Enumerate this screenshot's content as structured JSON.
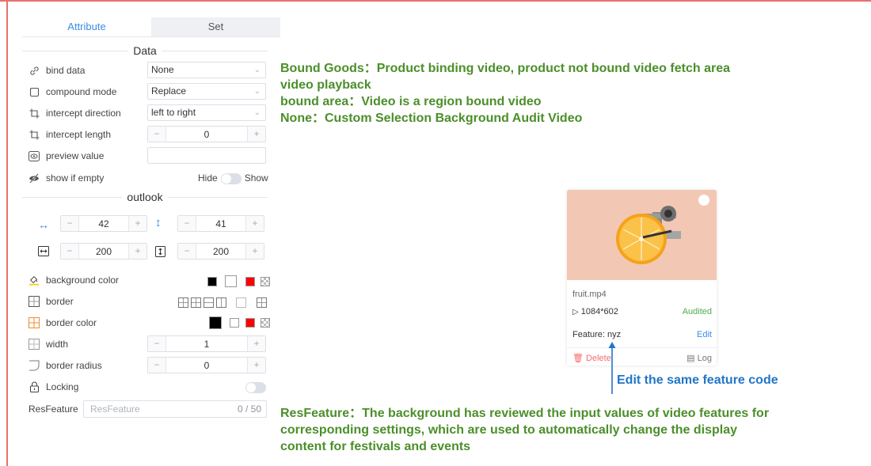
{
  "tabs": [
    {
      "label": "Attribute",
      "active": true
    },
    {
      "label": "Set",
      "active": false
    }
  ],
  "sections": {
    "data": "Data",
    "outlook": "outlook"
  },
  "fields": {
    "bind_data": {
      "label": "bind data",
      "value": "None"
    },
    "compound_mode": {
      "label": "compound mode",
      "value": "Replace"
    },
    "intercept_direction": {
      "label": "intercept direction",
      "value": "left to right"
    },
    "intercept_length": {
      "label": "intercept length",
      "value": "0"
    },
    "preview_value": {
      "label": "preview value",
      "value": ""
    },
    "show_if_empty": {
      "label": "show if empty",
      "off_label": "Hide",
      "on_label": "Show"
    }
  },
  "outlook": {
    "x": "42",
    "y": "41",
    "width": "200",
    "height": "200"
  },
  "style": {
    "background_color": {
      "label": "background color",
      "swatches": [
        "#000000",
        "#ffffff",
        "#ff0000",
        "checker"
      ]
    },
    "border": {
      "label": "border"
    },
    "border_color": {
      "label": "border color",
      "swatches": [
        "#000000",
        "#ffffff",
        "#ff0000",
        "checker"
      ]
    },
    "width": {
      "label": "width",
      "value": "1"
    },
    "border_radius": {
      "label": "border radius",
      "value": "0"
    },
    "locking": {
      "label": "Locking"
    },
    "res_feature": {
      "label": "ResFeature",
      "placeholder": "ResFeature",
      "counter": "0 / 50"
    }
  },
  "notes": {
    "goods_line1": "Bound Goods：Product binding video, product not bound video fetch area",
    "goods_line2": "video playback",
    "area": "bound area：Video is a region bound video",
    "none": "None：Custom Selection Background Audit Video",
    "edit": "Edit the same feature code",
    "res_line1": "ResFeature：The background has reviewed the input values of video features for",
    "res_line2": "corresponding settings, which are used to automatically change the display",
    "res_line3": "content for festivals and events"
  },
  "card": {
    "filename": "fruit.mp4",
    "resolution": "1084*602",
    "status": "Audited",
    "feature": "Feature: nyz",
    "edit": "Edit",
    "delete": "Delete",
    "log": "Log"
  },
  "colors": {
    "accent": "#3a8ee6",
    "note_green": "#4b8f2a",
    "note_blue": "#2176c7",
    "status_green": "#4caf50",
    "delete_red": "#f56c6c",
    "frame": "#e8716b"
  }
}
